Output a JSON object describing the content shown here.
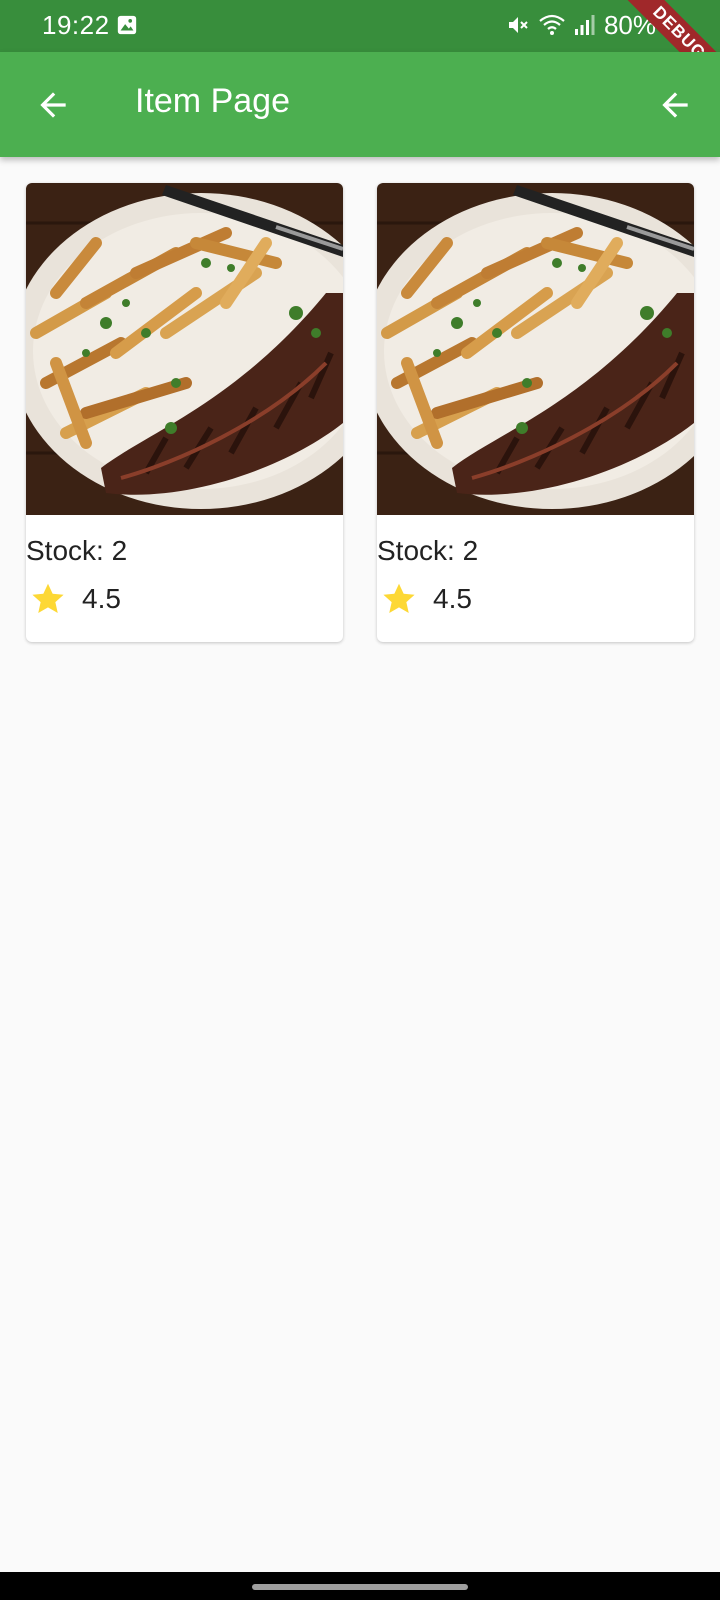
{
  "status_bar": {
    "time": "19:22",
    "battery": "80%",
    "debug_label": "DEBUG",
    "icons": [
      "gallery-icon",
      "mute-icon",
      "wifi-icon",
      "signal-icon",
      "battery-icon"
    ]
  },
  "app_bar": {
    "title": "Item Page",
    "leading_icon": "arrow-back-icon",
    "action_icon": "arrow-back-icon",
    "background": "#4caf50"
  },
  "items": [
    {
      "image": "steak-and-fries-plate",
      "stock": "Stock: 2",
      "rating": "4.5"
    },
    {
      "image": "steak-and-fries-plate",
      "stock": "Stock: 2",
      "rating": "4.5"
    }
  ],
  "colors": {
    "status_bar": "#388e3c",
    "app_bar": "#4caf50",
    "star": "#fdd835",
    "page_background": "#fafafa"
  }
}
